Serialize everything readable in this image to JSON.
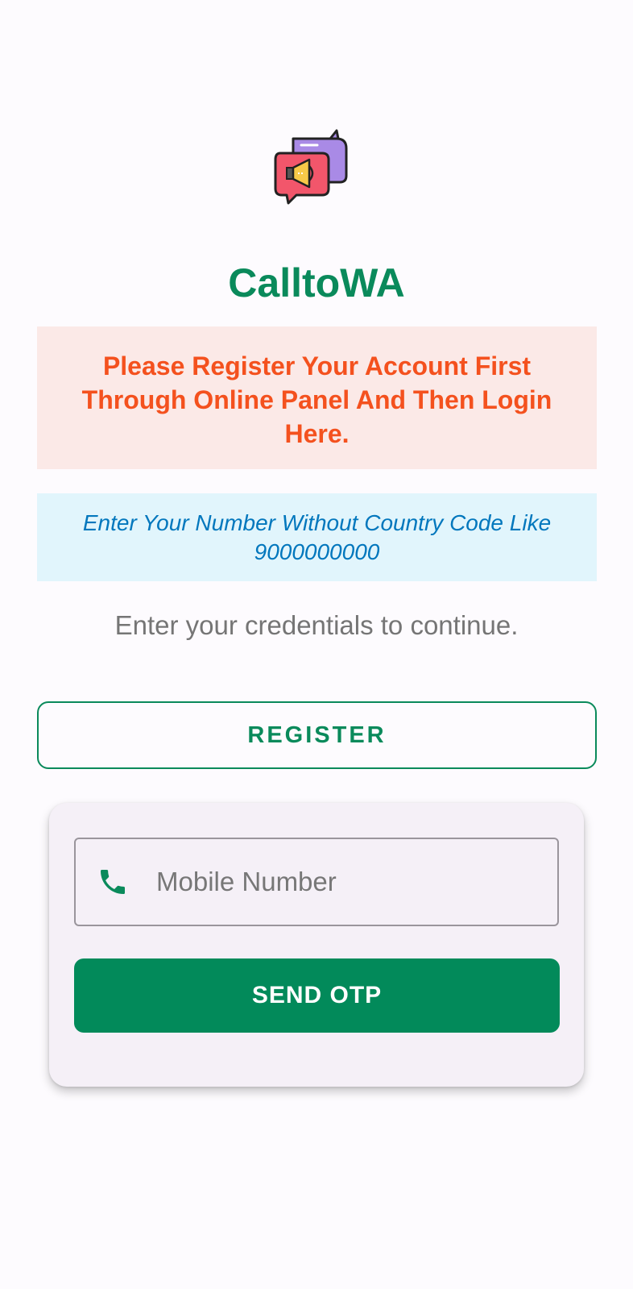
{
  "app": {
    "title": "CalltoWA",
    "logo_icon": "chat-megaphone-icon"
  },
  "notices": {
    "register_warning": "Please Register Your Account First Through Online Panel And Then Login Here.",
    "number_hint": "Enter Your Number Without Country Code Like 9000000000"
  },
  "login": {
    "subtitle": "Enter your credentials to continue.",
    "register_label": "REGISTER",
    "mobile_placeholder": "Mobile Number",
    "mobile_value": "",
    "mobile_icon": "phone-icon",
    "send_otp_label": "SEND OTP"
  },
  "colors": {
    "brand_green": "#0a8a5b",
    "warning_text": "#f4511e",
    "warning_bg": "#fbe9e7",
    "info_text": "#0277bd",
    "info_bg": "#e1f5fc"
  }
}
